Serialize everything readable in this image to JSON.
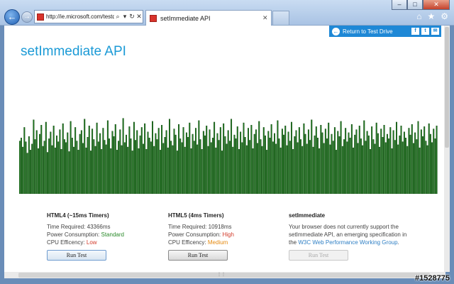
{
  "window": {
    "minimize": "–",
    "maximize": "□",
    "close": "✕"
  },
  "address": {
    "url": "http://ie.microsoft.com/testd",
    "search": "⌕",
    "dropdown": "▾",
    "refresh": "↻",
    "stop": "✕"
  },
  "tab": {
    "title": "setImmediate API",
    "close": "✕"
  },
  "toolbar": {
    "home": "⌂",
    "favorites": "★",
    "tools": "⚙"
  },
  "topbar": {
    "return_label": "Return to Test Drive",
    "facebook": "f",
    "twitter": "t",
    "email": "✉"
  },
  "page": {
    "title": "setImmediate API"
  },
  "columns": [
    {
      "heading": "HTML4 (~15ms Timers)",
      "time_label": "Time Required: ",
      "time_value": "43366ms",
      "power_label": "Power Consumption: ",
      "power_value": "Standard",
      "cpu_label": "CPU Efficency: ",
      "cpu_value": "Low",
      "button": "Run Test"
    },
    {
      "heading": "HTML5 (4ms Timers)",
      "time_label": "Time Required: ",
      "time_value": "10918ms",
      "power_label": "Power Consumption: ",
      "power_value": "High",
      "cpu_label": "CPU Efficency: ",
      "cpu_value": "Medium",
      "button": "Run Test"
    },
    {
      "heading": "setImmediate",
      "text1": "Your browser does not currently support the setImmediate API, an emerging specification in the ",
      "link": "W3C Web Performance Working Group",
      "text2": ".",
      "button": "Run Test"
    }
  ],
  "colors": {
    "accent": "#1b9ad6",
    "bar_fill": "#1f7a1f",
    "bar_stroke": "#0d3d0d"
  },
  "bars": {
    "max": 110,
    "values": [
      70,
      74,
      62,
      88,
      69,
      54,
      76,
      58,
      66,
      98,
      72,
      84,
      60,
      79,
      91,
      63,
      70,
      95,
      55,
      73,
      82,
      64,
      90,
      61,
      77,
      69,
      85,
      59,
      93,
      72,
      68,
      81,
      56,
      96,
      74,
      62,
      88,
      70,
      58,
      79,
      84,
      67,
      99,
      61,
      75,
      90,
      57,
      86,
      72,
      63,
      94,
      69,
      80,
      59,
      87,
      71,
      65,
      97,
      73,
      60,
      83,
      76,
      92,
      58,
      70,
      85,
      64,
      100,
      68,
      78,
      62,
      89,
      73,
      57,
      95,
      71,
      84,
      60,
      77,
      88,
      66,
      93,
      59,
      82,
      74,
      69,
      96,
      63,
      80,
      72,
      87,
      58,
      91,
      67,
      75,
      84,
      61,
      99,
      70,
      64,
      86,
      78,
      57,
      92,
      73,
      68,
      88,
      62,
      81,
      75,
      94,
      60,
      79,
      70,
      87,
      65,
      97,
      72,
      59,
      83,
      77,
      90,
      63,
      85,
      68,
      74,
      95,
      61,
      80,
      71,
      88,
      57,
      93,
      76,
      66,
      84,
      70,
      99,
      62,
      78,
      73,
      89,
      59,
      82,
      68,
      94,
      75,
      64,
      87,
      71,
      91,
      60,
      79,
      85,
      67,
      96,
      72,
      63,
      88,
      77,
      58,
      83,
      74,
      92,
      69,
      80,
      66,
      97,
      73,
      61,
      86,
      78,
      90,
      64,
      82,
      70,
      95,
      59,
      76,
      84,
      68,
      88,
      72,
      63,
      93,
      79,
      66,
      85,
      71,
      98,
      62,
      77,
      89,
      74,
      60,
      91,
      81,
      67,
      86,
      73,
      94,
      65,
      79,
      70,
      88,
      58,
      83,
      76,
      96,
      63,
      72,
      87,
      69,
      81,
      74,
      92,
      61,
      78,
      85,
      67,
      90,
      73,
      64,
      97,
      70,
      83,
      77,
      59,
      89,
      72,
      66,
      94,
      80,
      62,
      86,
      75,
      91,
      68,
      79,
      73,
      88,
      60,
      84,
      71,
      95,
      65,
      77,
      90,
      69,
      82,
      74,
      63,
      87,
      78,
      92,
      67,
      81,
      72,
      96,
      61,
      85,
      76,
      89,
      70,
      64,
      93,
      79,
      68,
      86,
      73,
      90
    ]
  }
}
